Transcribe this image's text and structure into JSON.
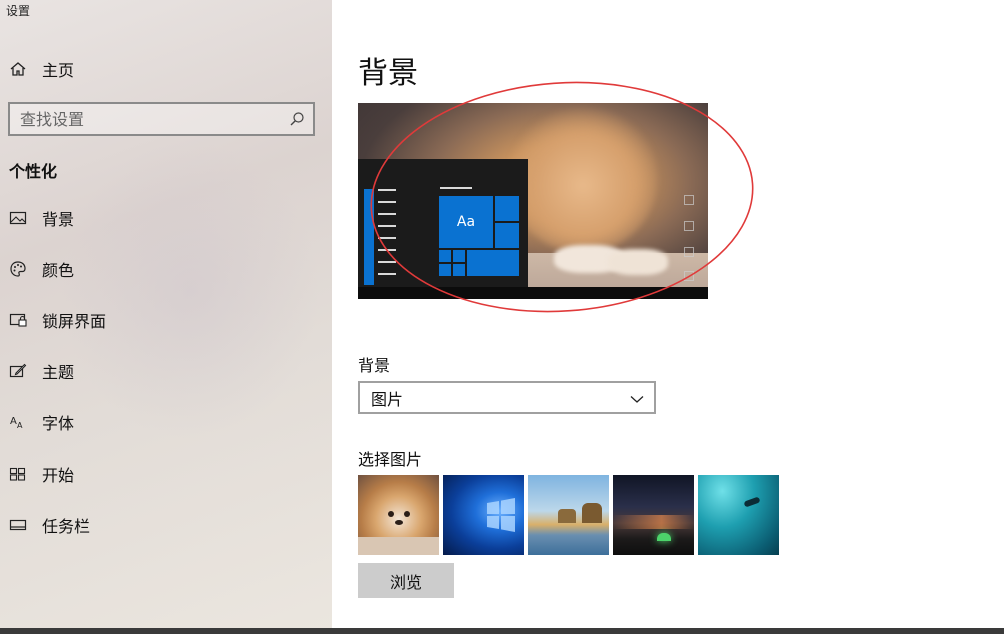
{
  "window": {
    "title": "设置"
  },
  "sidebar": {
    "home_label": "主页",
    "search_placeholder": "查找设置",
    "section_title": "个性化",
    "items": [
      {
        "label": "背景",
        "icon": "image-icon"
      },
      {
        "label": "颜色",
        "icon": "palette-icon"
      },
      {
        "label": "锁屏界面",
        "icon": "lock-screen-icon"
      },
      {
        "label": "主题",
        "icon": "theme-icon"
      },
      {
        "label": "字体",
        "icon": "font-icon"
      },
      {
        "label": "开始",
        "icon": "start-icon"
      },
      {
        "label": "任务栏",
        "icon": "taskbar-icon"
      }
    ]
  },
  "main": {
    "title": "背景",
    "preview": {
      "tile_text": "Aa"
    },
    "background_label": "背景",
    "background_value": "图片",
    "choose_picture_label": "选择图片",
    "browse_label": "浏览"
  },
  "colors": {
    "accent": "#0a72d1",
    "annotation": "#e03a3a"
  }
}
